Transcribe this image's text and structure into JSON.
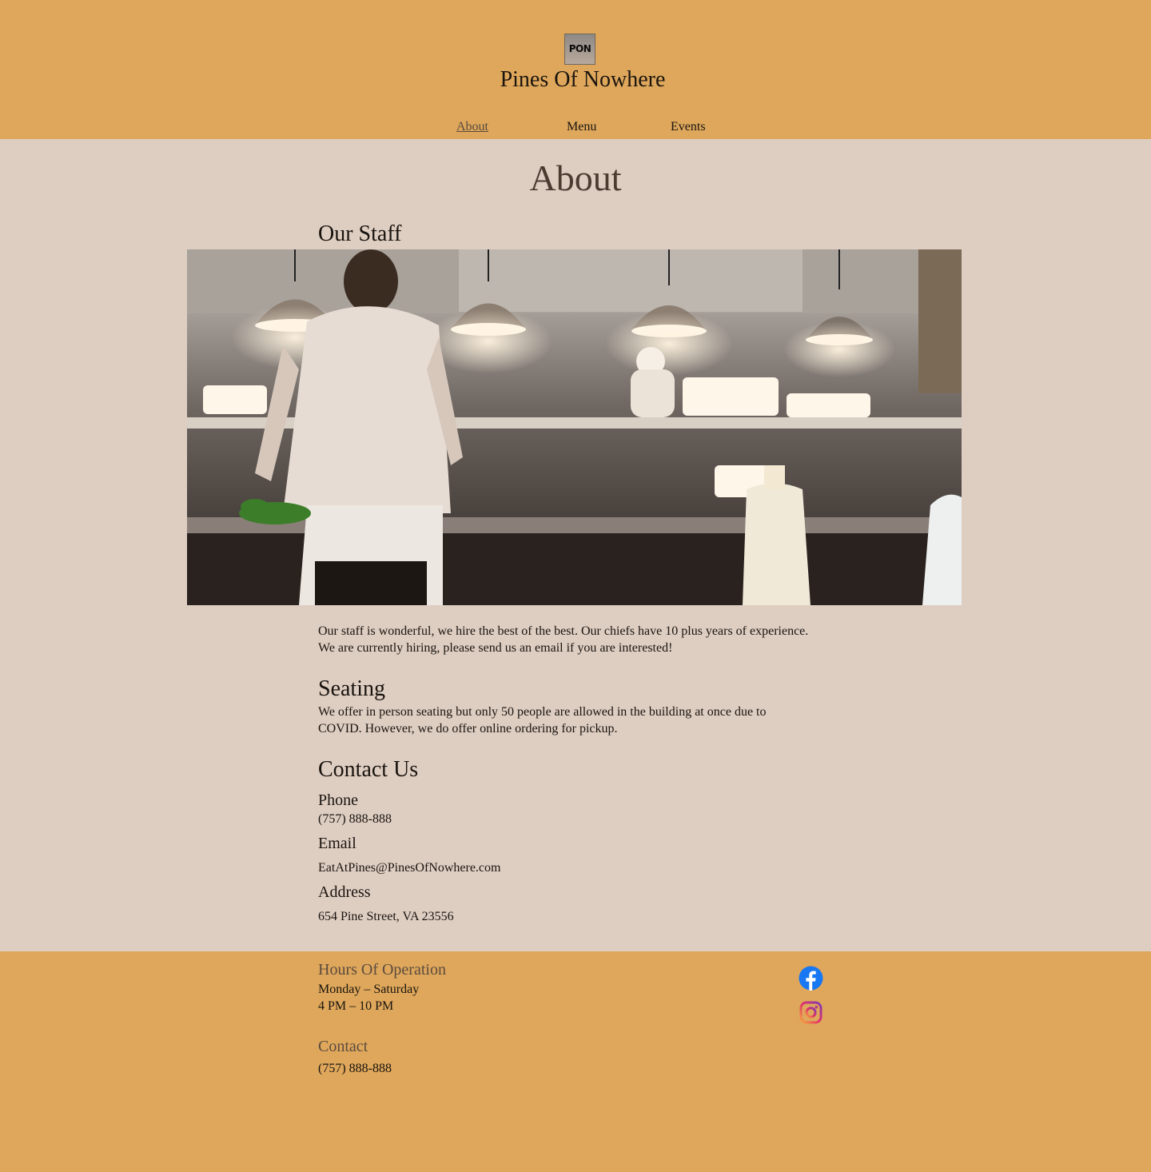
{
  "header": {
    "logo_text": "PON",
    "site_title": "Pines Of Nowhere",
    "nav": [
      {
        "label": "About",
        "active": true
      },
      {
        "label": "Menu",
        "active": false
      },
      {
        "label": "Events",
        "active": false
      }
    ]
  },
  "main": {
    "page_heading": "About",
    "staff": {
      "heading": "Our Staff",
      "image_alt": "Chefs working in a restaurant kitchen",
      "text_line1": "Our staff is wonderful, we hire the best of the best. Our chiefs have 10 plus years of experience.",
      "text_line2": "We are currently hiring, please send us an email if you are interested!"
    },
    "seating": {
      "heading": "Seating",
      "text_line1": "We offer in person seating but only 50 people are allowed in the building at once due to",
      "text_line2": "COVID. However, we do offer online ordering for pickup."
    },
    "contact": {
      "heading": "Contact Us",
      "phone_label": "Phone",
      "phone": "(757) 888-888",
      "email_label": "Email",
      "email": "EatAtPines@PinesOfNowhere.com",
      "address_label": "Address",
      "address": "654 Pine Street, VA 23556"
    }
  },
  "footer": {
    "hours_heading": "Hours Of Operation",
    "hours_days": "Monday  – Saturday",
    "hours_times": "4 PM  – 10 PM",
    "contact_heading": "Contact",
    "contact_phone": "(757) 888-888",
    "social": [
      {
        "icon": "facebook-icon",
        "color": "#1877f2"
      },
      {
        "icon": "instagram-icon",
        "color": "#c13584"
      }
    ]
  },
  "colors": {
    "header_bg": "#dea75b",
    "main_bg": "#decec2",
    "footer_bg": "#dea75b"
  }
}
